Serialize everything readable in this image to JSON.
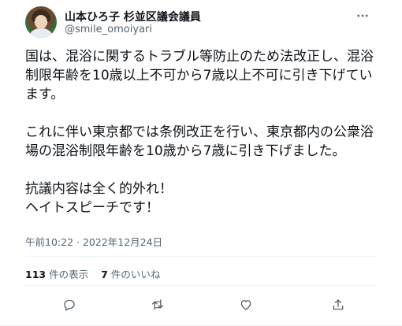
{
  "author": {
    "display_name": "山本ひろ子 杉並区議会議員",
    "handle": "@smile_omoiyari"
  },
  "tweet": {
    "text": "国は、混浴に関するトラブル等防止のため法改正し、混浴制限年齢を10歳以上不可から7歳以上不可に引き下げています。\n\nこれに伴い東京都では条例改正を行い、東京都内の公衆浴場の混浴制限年齢を10歳から7歳に引き下げました。\n\n抗議内容は全く的外れ！\nヘイトスピーチです！",
    "timestamp": "午前10:22 · 2022年12月24日"
  },
  "stats": {
    "views_count": "113",
    "views_label": "件の表示",
    "likes_count": "7",
    "likes_label": "件のいいね"
  },
  "icons": {
    "more": "more-icon",
    "reply": "reply-icon",
    "retweet": "retweet-icon",
    "like": "heart-icon",
    "share": "share-icon"
  },
  "colors": {
    "text": "#0f1419",
    "secondary": "#536471",
    "divider": "#eff3f4"
  }
}
